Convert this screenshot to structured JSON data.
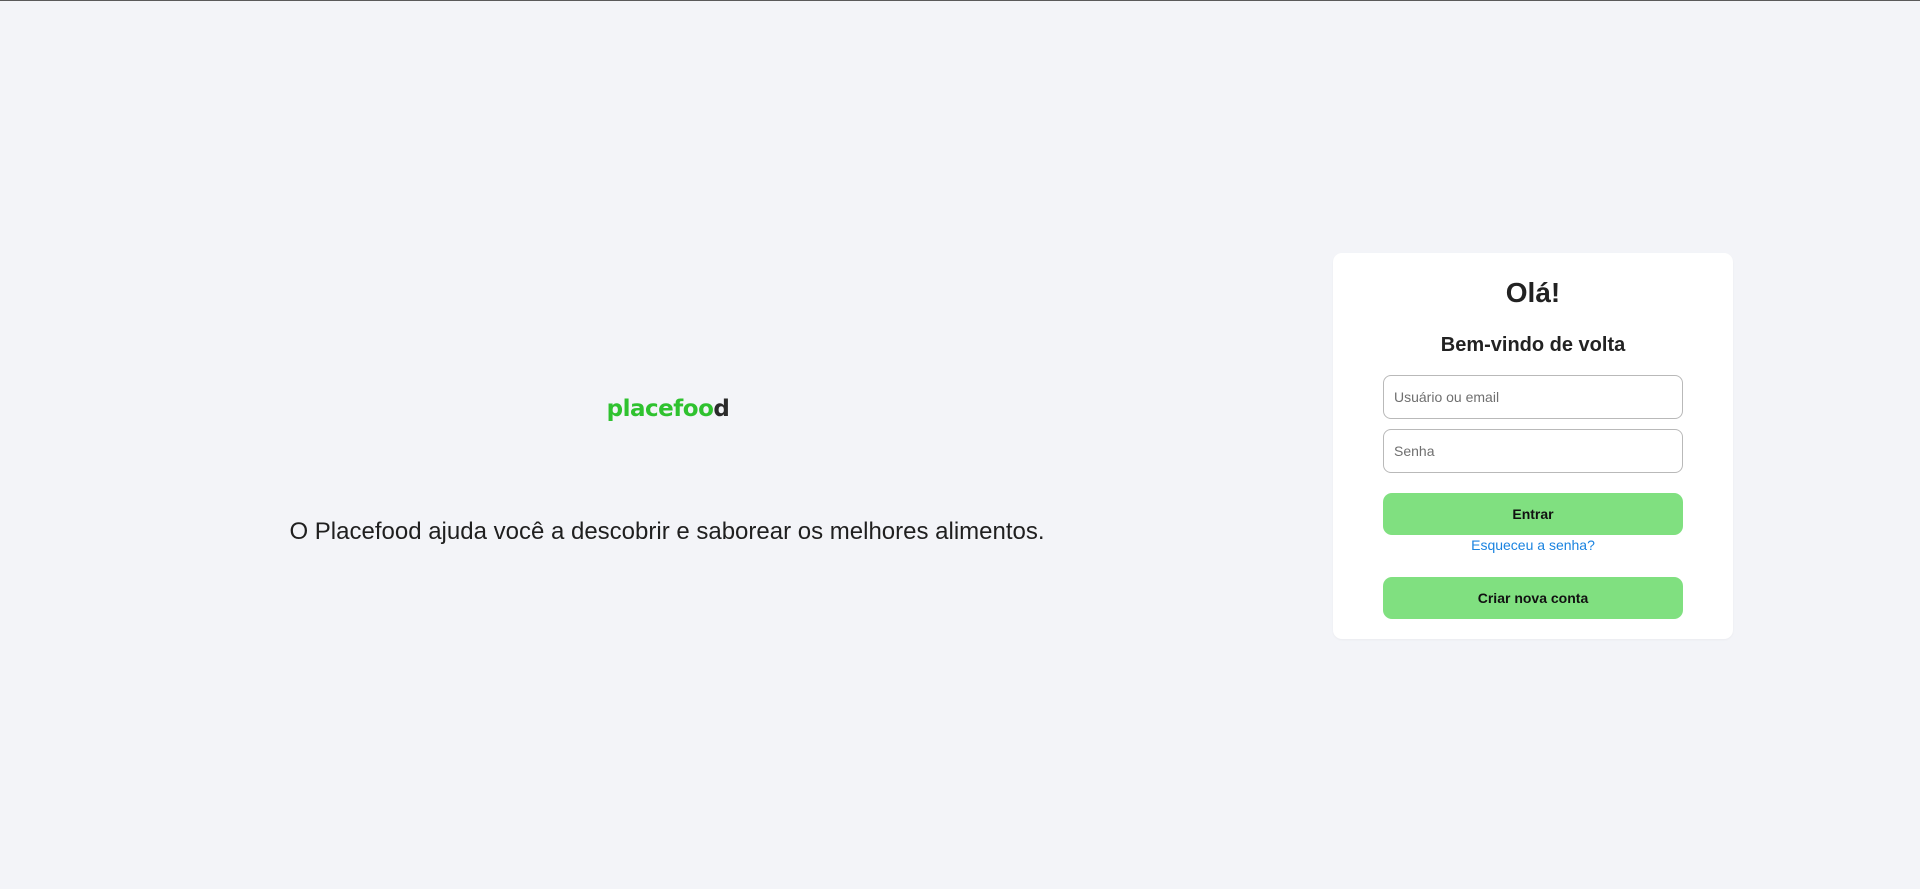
{
  "brand": {
    "logo_part1": "place",
    "logo_part2": "foo",
    "logo_part3": "d",
    "logo_color": "#2fc22f"
  },
  "hero": {
    "tagline": "O Placefood ajuda você a descobrir e saborear os melhores alimentos."
  },
  "login": {
    "title": "Olá!",
    "subtitle": "Bem-vindo de volta",
    "username_placeholder": "Usuário ou email",
    "password_placeholder": "Senha",
    "submit_label": "Entrar",
    "forgot_label": "Esqueceu a senha?",
    "create_account_label": "Criar nova conta",
    "button_color": "#80e080",
    "link_color": "#1a83e0"
  }
}
